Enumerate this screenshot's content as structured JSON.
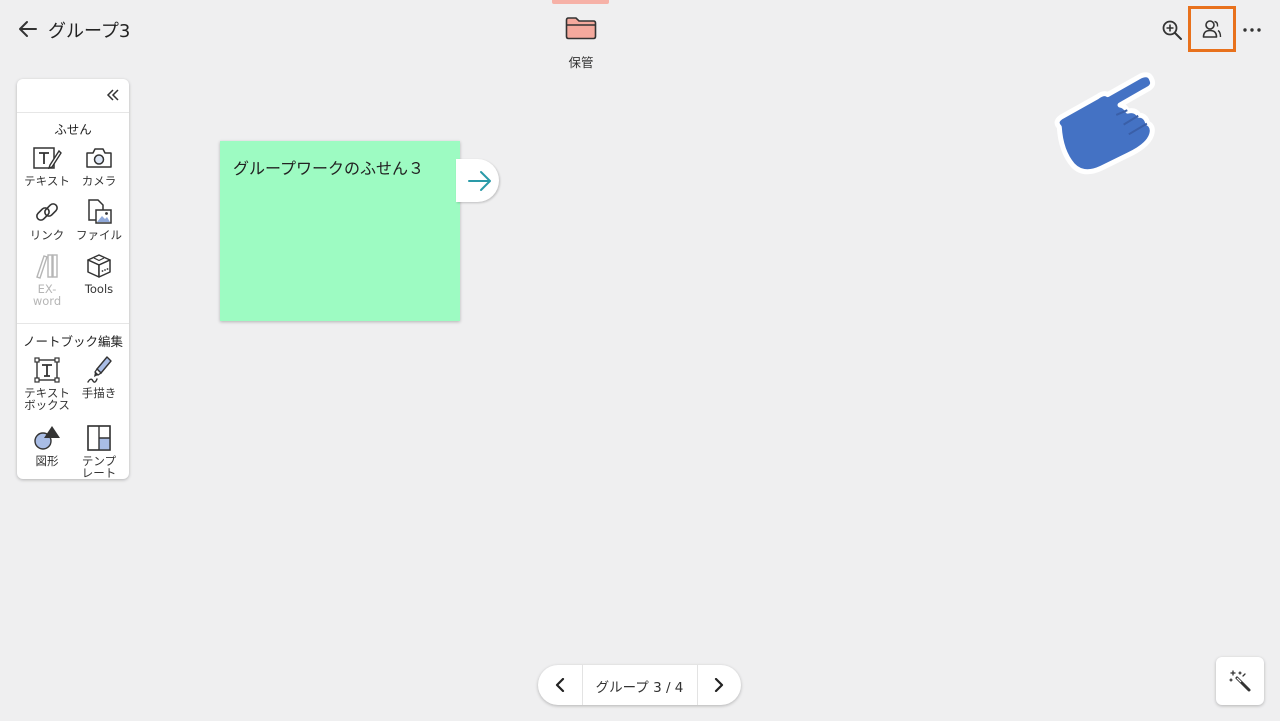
{
  "header": {
    "title": "グループ3",
    "storage_label": "保管",
    "colors": {
      "highlight": "#e8711c",
      "storage_accent": "#f6b1a7",
      "folder": "#f4a99d"
    }
  },
  "sidebar": {
    "section1_title": "ふせん",
    "section2_title": "ノートブック編集",
    "tools": {
      "text": {
        "label": "テキスト"
      },
      "camera": {
        "label": "カメラ"
      },
      "link": {
        "label": "リンク"
      },
      "file": {
        "label": "ファイル"
      },
      "exword": {
        "label_line1": "EX-",
        "label_line2": "word"
      },
      "tools": {
        "label": "Tools"
      },
      "textbox": {
        "label_line1": "テキスト",
        "label_line2": "ボックス"
      },
      "handwrite": {
        "label": "手描き"
      },
      "shape": {
        "label": "図形"
      },
      "template": {
        "label_line1": "テンプ",
        "label_line2": "レート"
      }
    }
  },
  "canvas": {
    "sticky_note": {
      "text": "グループワークのふせん３",
      "color": "#9dfbc2"
    }
  },
  "pager": {
    "label": "グループ 3 / 4"
  }
}
